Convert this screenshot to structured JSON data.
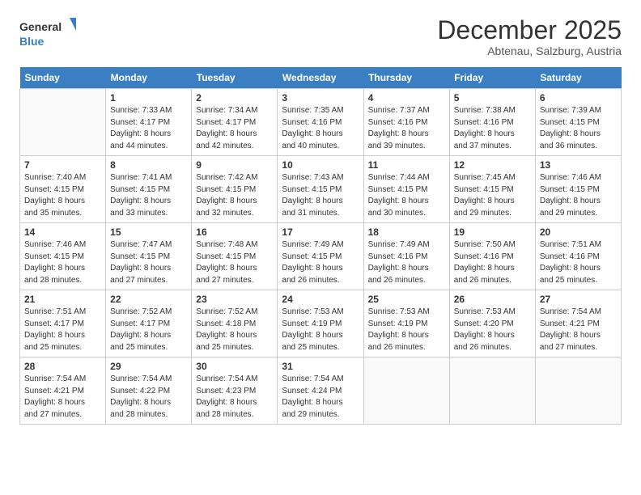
{
  "logo": {
    "line1": "General",
    "line2": "Blue"
  },
  "title": "December 2025",
  "subtitle": "Abtenau, Salzburg, Austria",
  "days_header": [
    "Sunday",
    "Monday",
    "Tuesday",
    "Wednesday",
    "Thursday",
    "Friday",
    "Saturday"
  ],
  "weeks": [
    [
      {
        "day": "",
        "sunrise": "",
        "sunset": "",
        "daylight": ""
      },
      {
        "day": "1",
        "sunrise": "7:33 AM",
        "sunset": "4:17 PM",
        "hours": "8 hours",
        "minutes": "and 44 minutes."
      },
      {
        "day": "2",
        "sunrise": "7:34 AM",
        "sunset": "4:17 PM",
        "hours": "8 hours",
        "minutes": "and 42 minutes."
      },
      {
        "day": "3",
        "sunrise": "7:35 AM",
        "sunset": "4:16 PM",
        "hours": "8 hours",
        "minutes": "and 40 minutes."
      },
      {
        "day": "4",
        "sunrise": "7:37 AM",
        "sunset": "4:16 PM",
        "hours": "8 hours",
        "minutes": "and 39 minutes."
      },
      {
        "day": "5",
        "sunrise": "7:38 AM",
        "sunset": "4:16 PM",
        "hours": "8 hours",
        "minutes": "and 37 minutes."
      },
      {
        "day": "6",
        "sunrise": "7:39 AM",
        "sunset": "4:15 PM",
        "hours": "8 hours",
        "minutes": "and 36 minutes."
      }
    ],
    [
      {
        "day": "7",
        "sunrise": "7:40 AM",
        "sunset": "4:15 PM",
        "hours": "8 hours",
        "minutes": "and 35 minutes."
      },
      {
        "day": "8",
        "sunrise": "7:41 AM",
        "sunset": "4:15 PM",
        "hours": "8 hours",
        "minutes": "and 33 minutes."
      },
      {
        "day": "9",
        "sunrise": "7:42 AM",
        "sunset": "4:15 PM",
        "hours": "8 hours",
        "minutes": "and 32 minutes."
      },
      {
        "day": "10",
        "sunrise": "7:43 AM",
        "sunset": "4:15 PM",
        "hours": "8 hours",
        "minutes": "and 31 minutes."
      },
      {
        "day": "11",
        "sunrise": "7:44 AM",
        "sunset": "4:15 PM",
        "hours": "8 hours",
        "minutes": "and 30 minutes."
      },
      {
        "day": "12",
        "sunrise": "7:45 AM",
        "sunset": "4:15 PM",
        "hours": "8 hours",
        "minutes": "and 29 minutes."
      },
      {
        "day": "13",
        "sunrise": "7:46 AM",
        "sunset": "4:15 PM",
        "hours": "8 hours",
        "minutes": "and 29 minutes."
      }
    ],
    [
      {
        "day": "14",
        "sunrise": "7:46 AM",
        "sunset": "4:15 PM",
        "hours": "8 hours",
        "minutes": "and 28 minutes."
      },
      {
        "day": "15",
        "sunrise": "7:47 AM",
        "sunset": "4:15 PM",
        "hours": "8 hours",
        "minutes": "and 27 minutes."
      },
      {
        "day": "16",
        "sunrise": "7:48 AM",
        "sunset": "4:15 PM",
        "hours": "8 hours",
        "minutes": "and 27 minutes."
      },
      {
        "day": "17",
        "sunrise": "7:49 AM",
        "sunset": "4:15 PM",
        "hours": "8 hours",
        "minutes": "and 26 minutes."
      },
      {
        "day": "18",
        "sunrise": "7:49 AM",
        "sunset": "4:16 PM",
        "hours": "8 hours",
        "minutes": "and 26 minutes."
      },
      {
        "day": "19",
        "sunrise": "7:50 AM",
        "sunset": "4:16 PM",
        "hours": "8 hours",
        "minutes": "and 26 minutes."
      },
      {
        "day": "20",
        "sunrise": "7:51 AM",
        "sunset": "4:16 PM",
        "hours": "8 hours",
        "minutes": "and 25 minutes."
      }
    ],
    [
      {
        "day": "21",
        "sunrise": "7:51 AM",
        "sunset": "4:17 PM",
        "hours": "8 hours",
        "minutes": "and 25 minutes."
      },
      {
        "day": "22",
        "sunrise": "7:52 AM",
        "sunset": "4:17 PM",
        "hours": "8 hours",
        "minutes": "and 25 minutes."
      },
      {
        "day": "23",
        "sunrise": "7:52 AM",
        "sunset": "4:18 PM",
        "hours": "8 hours",
        "minutes": "and 25 minutes."
      },
      {
        "day": "24",
        "sunrise": "7:53 AM",
        "sunset": "4:19 PM",
        "hours": "8 hours",
        "minutes": "and 25 minutes."
      },
      {
        "day": "25",
        "sunrise": "7:53 AM",
        "sunset": "4:19 PM",
        "hours": "8 hours",
        "minutes": "and 26 minutes."
      },
      {
        "day": "26",
        "sunrise": "7:53 AM",
        "sunset": "4:20 PM",
        "hours": "8 hours",
        "minutes": "and 26 minutes."
      },
      {
        "day": "27",
        "sunrise": "7:54 AM",
        "sunset": "4:21 PM",
        "hours": "8 hours",
        "minutes": "and 27 minutes."
      }
    ],
    [
      {
        "day": "28",
        "sunrise": "7:54 AM",
        "sunset": "4:21 PM",
        "hours": "8 hours",
        "minutes": "and 27 minutes."
      },
      {
        "day": "29",
        "sunrise": "7:54 AM",
        "sunset": "4:22 PM",
        "hours": "8 hours",
        "minutes": "and 28 minutes."
      },
      {
        "day": "30",
        "sunrise": "7:54 AM",
        "sunset": "4:23 PM",
        "hours": "8 hours",
        "minutes": "and 28 minutes."
      },
      {
        "day": "31",
        "sunrise": "7:54 AM",
        "sunset": "4:24 PM",
        "hours": "8 hours",
        "minutes": "and 29 minutes."
      },
      {
        "day": "",
        "sunrise": "",
        "sunset": "",
        "hours": "",
        "minutes": ""
      },
      {
        "day": "",
        "sunrise": "",
        "sunset": "",
        "hours": "",
        "minutes": ""
      },
      {
        "day": "",
        "sunrise": "",
        "sunset": "",
        "hours": "",
        "minutes": ""
      }
    ]
  ],
  "labels": {
    "sunrise": "Sunrise:",
    "sunset": "Sunset:",
    "daylight": "Daylight:"
  },
  "colors": {
    "header_bg": "#3a7fc1",
    "header_text": "#ffffff"
  }
}
